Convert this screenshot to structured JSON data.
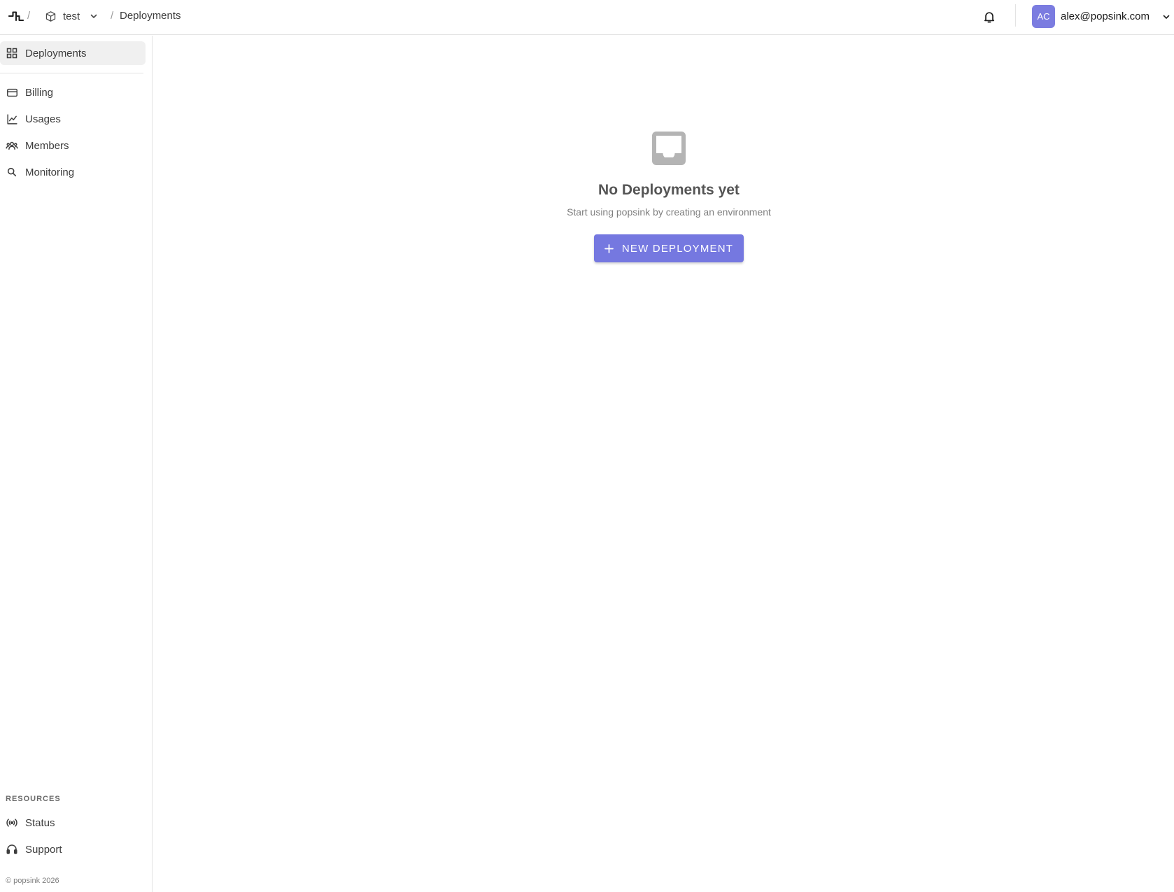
{
  "topbar": {
    "separator": "/",
    "project": {
      "name": "test"
    },
    "current_page": "Deployments",
    "user": {
      "initials": "AC",
      "email": "alex@popsink.com"
    }
  },
  "sidebar": {
    "items": [
      {
        "label": "Deployments",
        "icon": "grid-icon",
        "active": true
      },
      {
        "label": "Billing",
        "icon": "credit-card-icon",
        "active": false
      },
      {
        "label": "Usages",
        "icon": "line-chart-icon",
        "active": false
      },
      {
        "label": "Members",
        "icon": "users-icon",
        "active": false
      },
      {
        "label": "Monitoring",
        "icon": "search-icon",
        "active": false
      }
    ],
    "resources": {
      "title": "RESOURCES",
      "items": [
        {
          "label": "Status",
          "icon": "broadcast-icon"
        },
        {
          "label": "Support",
          "icon": "headset-icon"
        }
      ]
    },
    "copyright": "© popsink 2026"
  },
  "empty_state": {
    "icon": "inbox-icon",
    "title": "No Deployments yet",
    "subtitle": "Start using popsink by creating an environment",
    "button_label": "NEW DEPLOYMENT",
    "button_icon": "plus-icon"
  },
  "colors": {
    "accent": "#7578e0",
    "avatar": "#7b7ce0",
    "active_nav_bg": "#f0f0f0",
    "border": "#e3e3e3"
  }
}
